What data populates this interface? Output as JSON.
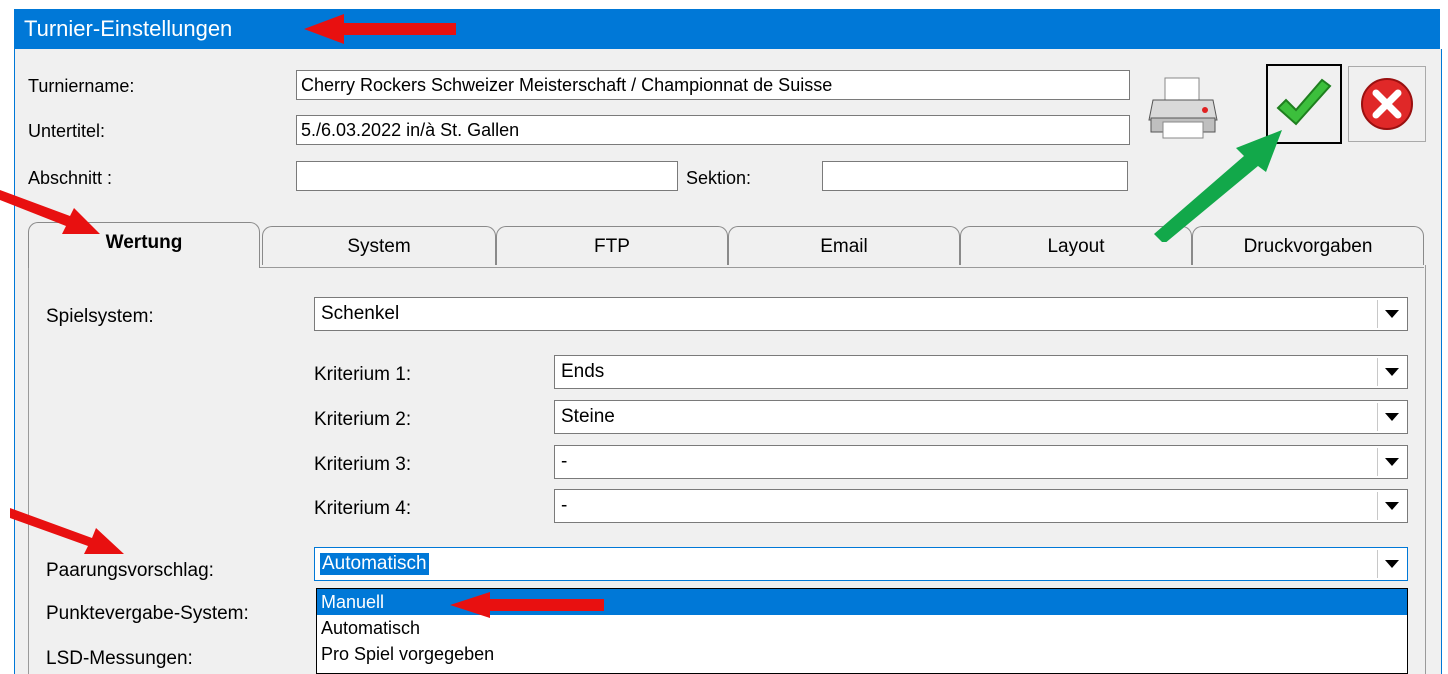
{
  "window": {
    "title": "Turnier-Einstellungen"
  },
  "header": {
    "turniername_label": "Turniername:",
    "turniername_value": "Cherry Rockers Schweizer Meisterschaft / Championnat de Suisse",
    "untertitel_label": "Untertitel:",
    "untertitel_value": "5./6.03.2022 in/à St. Gallen",
    "abschnitt_label": "Abschnitt :",
    "abschnitt_value": "",
    "sektion_label": "Sektion:",
    "sektion_value": ""
  },
  "toolbar": {
    "print_icon": "printer-icon",
    "ok_icon": "green-checkmark-icon",
    "cancel_icon": "red-x-icon"
  },
  "tabs": [
    {
      "label": "Wertung",
      "active": true
    },
    {
      "label": "System"
    },
    {
      "label": "FTP"
    },
    {
      "label": "Email"
    },
    {
      "label": "Layout"
    },
    {
      "label": "Druckvorgaben"
    }
  ],
  "wertung": {
    "spielsystem_label": "Spielsystem:",
    "spielsystem_value": "Schenkel",
    "kriterien": [
      {
        "label": "Kriterium 1:",
        "value": "Ends"
      },
      {
        "label": "Kriterium 2:",
        "value": "Steine"
      },
      {
        "label": "Kriterium 3:",
        "value": "-"
      },
      {
        "label": "Kriterium 4:",
        "value": "-"
      }
    ],
    "paarung_label": "Paarungsvorschlag:",
    "paarung_value": "Automatisch",
    "paarung_options": [
      "Manuell",
      "Automatisch",
      "Pro Spiel vorgegeben"
    ],
    "punkte_label": "Punktevergabe-System:",
    "lsd_label": "LSD-Messungen:"
  },
  "colors": {
    "titlebar": "#0078d7",
    "selection": "#0078d7",
    "annotation_red": "#e81010",
    "annotation_green": "#12a84a"
  }
}
